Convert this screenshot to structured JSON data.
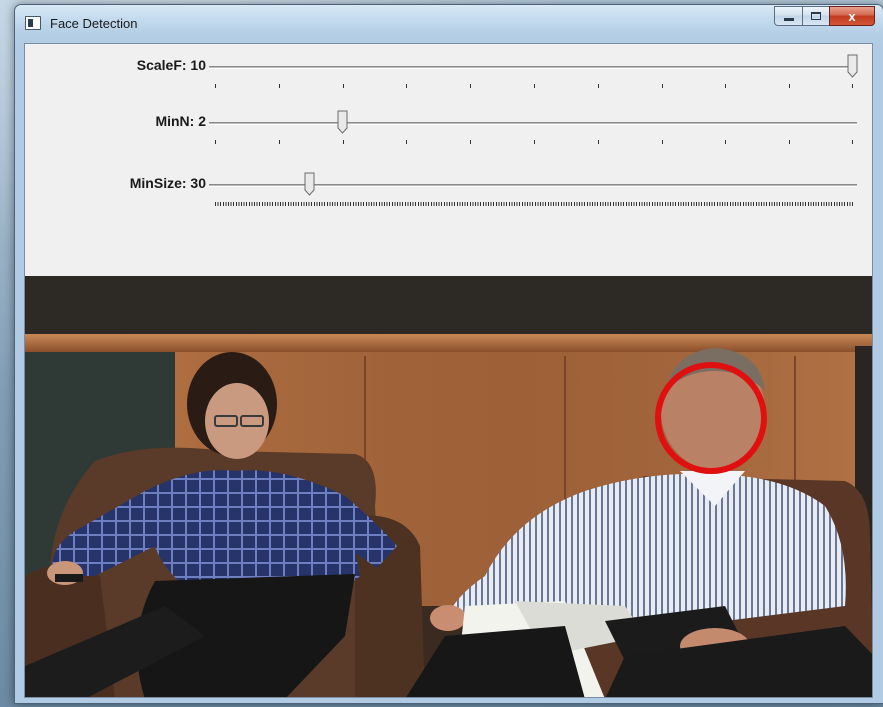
{
  "window": {
    "title": "Face Detection",
    "app_icon": "window-app-icon",
    "buttons": {
      "minimize_icon": "minimize-icon",
      "maximize_icon": "maximize-icon",
      "close_label": "x"
    }
  },
  "trackbars": [
    {
      "label": "ScaleF: 10",
      "value": 10,
      "max": 10,
      "tick_count": 11
    },
    {
      "label": "MinN: 2",
      "value": 2,
      "max": 10,
      "tick_count": 11
    },
    {
      "label": "MinSize: 30",
      "value": 30,
      "max": 200,
      "tick_count": 200
    }
  ],
  "video": {
    "description_icon": "video-frame",
    "detection_color": "#e01010",
    "detections": 1
  },
  "colors": {
    "panel_bg": "#f0f0f0",
    "titlebar": "#c4dbee",
    "close_red": "#c23b1e",
    "detection_circle": "#e01010"
  }
}
